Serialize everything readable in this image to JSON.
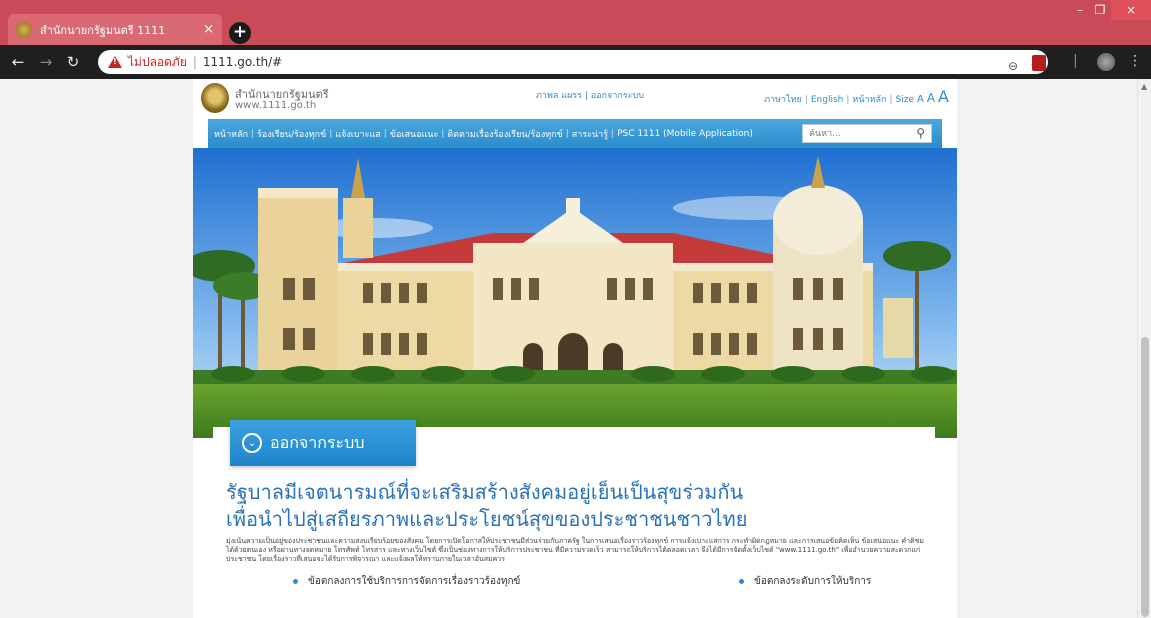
{
  "browser": {
    "tab_title": "สำนักนายกรัฐมนตรี 1111",
    "tab_close": "×",
    "new_tab": "+",
    "window_controls": [
      "–",
      "❐",
      "×"
    ],
    "not_secure_label": "ไม่ปลอดภัย",
    "url": "1111.go.th/#",
    "url_separator": "|",
    "tab_color": "#c94b58"
  },
  "site": {
    "org_name": "สำนักนายกรัฐมนตรี",
    "org_url": "www.1111.go.th",
    "top_links": "ภาพล แผรร | ออกจากระบบ",
    "lang": {
      "thai": "ภาษาไทย",
      "english": "English",
      "home": "หน้าหลัก",
      "size": "Size",
      "a_small": "A",
      "a_medium": "A",
      "a_large": "A"
    },
    "nav": [
      "หน้าหลัก",
      "ร้องเรียน/ร้องทุกข์",
      "แจ้งเบาะแส",
      "ข้อเสนอแนะ",
      "ติดตามเรื่องร้องเรียน/ร้องทุกข์",
      "สาระน่ารู้",
      "PSC 1111 (Mobile Application)"
    ],
    "search_placeholder": "ค้นหา...",
    "logout_label": "ออกจากระบบ",
    "headline_1": "รัฐบาลมีเจตนารมณ์ที่จะเสริมสร้างสังคมอยู่เย็นเป็นสุขร่วมกัน",
    "headline_2": "เพื่อนำไปสู่เสถียรภาพและประโยชน์สุขของประชาชนชาวไทย",
    "body": "มุ่งเน้นความเป็นอยู่ของประชาชนและความสงบเรียบร้อยของสังคม โดยการเปิดโอกาสให้ประชาชนมีส่วนร่วมกับภาครัฐ ในการเสนอเรื่องราวร้องทุกข์ การแจ้งเบาะแสการ กระทำผิดกฎหมาย และการเสนอข้อคิดเห็น ข้อเสนอแนะ คำติชมได้ด้วยตนเอง หรือผ่านทางจดหมาย โทรศัพท์ โทรสาร และทางเว็บไซต์ ซึ่งเป็นช่องทางการให้บริการประชาชน ที่มีความรวดเร็ว สามารถให้บริการได้ตลอดเวลา จึงได้มีการจัดตั้งเว็บไซต์ \"www.1111.go.th\" เพื่ออำนวยความสะดวกแก่ประชาชน โดยเรื่องราวที่เสนอจะได้รับการพิจารณา และแจ้งผลให้ทราบภายในเวลาอันสมควร",
    "bullet_left": "ข้อตกลงการใช้บริการการจัดการเรื่องราวร้องทุกข์",
    "bullet_right": "ข้อตกลงระดับการให้บริการ",
    "accent": "#2a8ed0"
  }
}
